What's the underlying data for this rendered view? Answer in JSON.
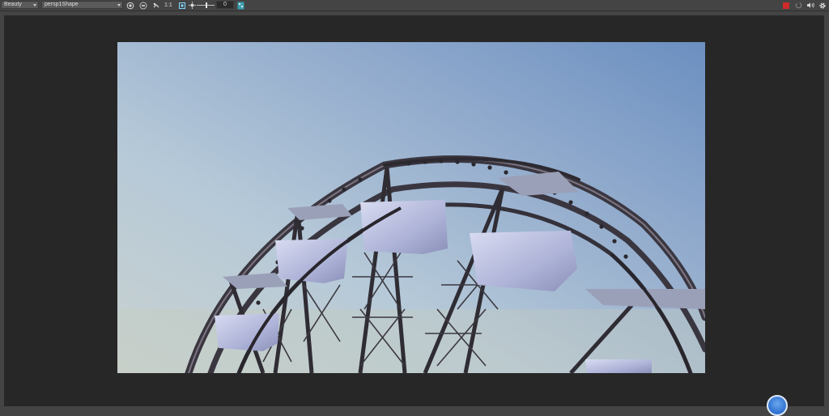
{
  "toolbar": {
    "display_mode": {
      "value": "Beauty",
      "icon": "chevron-down-icon"
    },
    "camera": {
      "value": "persp1Shape",
      "icon": "chevron-down-icon"
    },
    "render_region_icon": "region-icon",
    "snapshot_icon": "snapshot-icon",
    "refresh_icon": "refresh-icon",
    "pixel_ratio": "1:1",
    "frame_icon": "frame-icon",
    "exposure_icon": "sun-icon",
    "exposure_value": "0",
    "channel_icon": "channel-icon",
    "stop_icon": "stop-icon",
    "sync_icon": "sync-icon",
    "audio_icon": "audio-icon",
    "settings_icon": "gear-icon"
  },
  "colors": {
    "ui_bg": "#444444",
    "viewport_bg": "#272727",
    "stop_red": "#d02a2a",
    "accent_blue": "#3c86e0"
  },
  "viewport": {
    "content": "ferris-wheel-render",
    "hud_button_icon": "hud-circle-icon"
  }
}
